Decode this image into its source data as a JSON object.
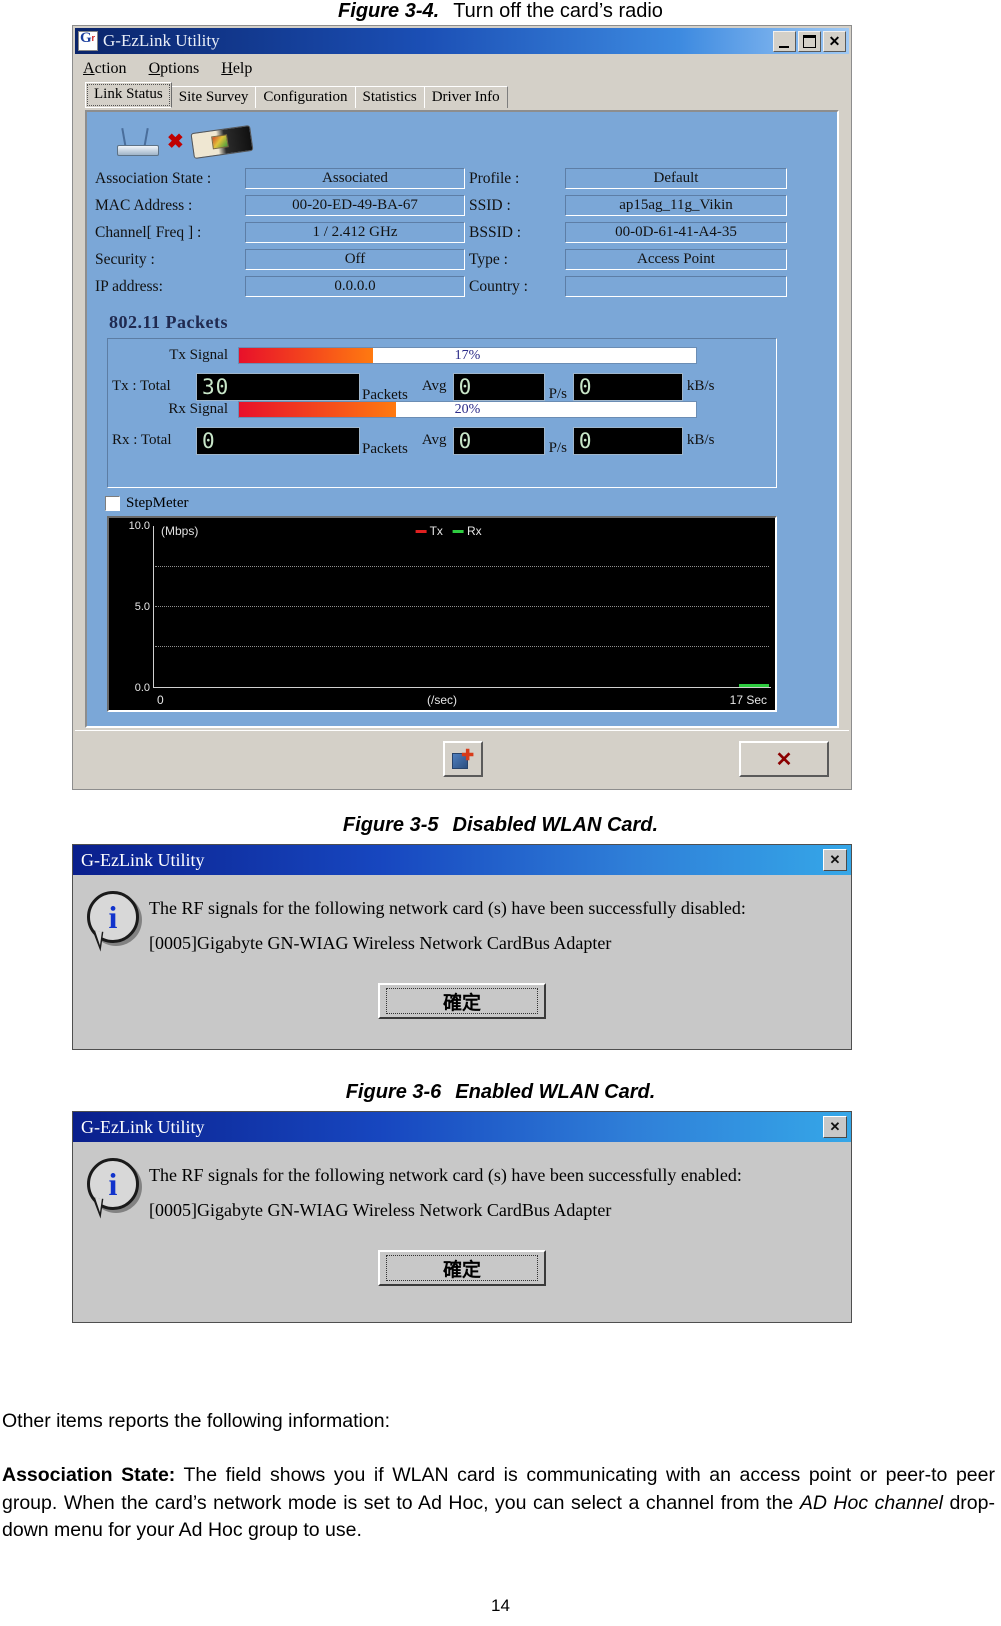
{
  "figures": {
    "fig34": {
      "label": "Figure 3-4.",
      "text": "Turn off the card’s radio"
    },
    "fig35": {
      "label": "Figure 3-5",
      "text": "Disabled WLAN Card."
    },
    "fig36": {
      "label": "Figure 3-6",
      "text": "Enabled WLAN Card."
    }
  },
  "utility": {
    "title": "G-EzLink Utility",
    "window_buttons": {
      "minimize": "_",
      "maximize": "□",
      "close": "✕"
    },
    "menu": [
      "Action",
      "Options",
      "Help"
    ],
    "tabs": [
      {
        "label": "Link Status",
        "active": true
      },
      {
        "label": "Site Survey",
        "active": false
      },
      {
        "label": "Configuration",
        "active": false
      },
      {
        "label": "Statistics",
        "active": false
      },
      {
        "label": "Driver Info",
        "active": false
      }
    ],
    "status_icons": {
      "access_point": "access-point-icon",
      "disconnect": "✖",
      "card": "pc-card-icon"
    },
    "fields_left": [
      {
        "label": "Association State :",
        "value": "Associated"
      },
      {
        "label": "MAC Address :",
        "value": "00-20-ED-49-BA-67"
      },
      {
        "label": "Channel[ Freq ] :",
        "value": "1 / 2.412 GHz"
      },
      {
        "label": "Security :",
        "value": "Off"
      },
      {
        "label": "IP address:",
        "value": "0.0.0.0"
      }
    ],
    "fields_right": [
      {
        "label": "Profile :",
        "value": "Default"
      },
      {
        "label": "SSID :",
        "value": "ap15ag_11g_Vikin"
      },
      {
        "label": "BSSID :",
        "value": "00-0D-61-41-A4-35"
      },
      {
        "label": "Type :",
        "value": "Access Point"
      },
      {
        "label": "Country :",
        "value": ""
      }
    ],
    "packets": {
      "section_title": "802.11  Packets",
      "tx_signal_label": "Tx Signal",
      "tx_signal_pct": "17%",
      "tx_signal_value": 17,
      "rx_signal_label": "Rx Signal",
      "rx_signal_pct": "20%",
      "rx_signal_value": 20,
      "tx_row_label": "Tx :  Total",
      "rx_row_label": "Rx :  Total",
      "tx_total": "30",
      "rx_total": "0",
      "tx_avg": "0",
      "rx_avg": "0",
      "tx_rate": "0",
      "rx_rate": "0",
      "packets_unit": "Packets",
      "avg_label": "Avg",
      "ps_unit": "P/s",
      "kbs_unit": "kB/s",
      "stepmeter_label": "StepMeter",
      "stepmeter_checked": false
    },
    "buttons": {
      "radio_toggle": "radio-toggle-icon",
      "close": "✕"
    }
  },
  "chart_data": {
    "type": "line",
    "title": "",
    "ylabel": "(Mbps)",
    "xlabel": "(/sec)",
    "ylim": [
      0,
      10
    ],
    "yticks": [
      "0.0",
      "5.0",
      "10.0"
    ],
    "xticks": [
      "0",
      "17 Sec"
    ],
    "xlim_label_left": "0",
    "xlim_label_right": "17 Sec",
    "grid": true,
    "legend_position": "top-center",
    "series": [
      {
        "name": "Tx",
        "color": "#e02020",
        "values": [
          0,
          0,
          0,
          0,
          0,
          0,
          0,
          0,
          0,
          0,
          0,
          0,
          0,
          0,
          0,
          0,
          0,
          0
        ]
      },
      {
        "name": "Rx",
        "color": "#2ecc40",
        "values": [
          0,
          0,
          0,
          0,
          0,
          0,
          0,
          0,
          0,
          0,
          0,
          0,
          0,
          0,
          0,
          0,
          0.1,
          0.1
        ]
      }
    ],
    "x": [
      0,
      1,
      2,
      3,
      4,
      5,
      6,
      7,
      8,
      9,
      10,
      11,
      12,
      13,
      14,
      15,
      16,
      17
    ]
  },
  "dialog_disabled": {
    "title": "G-EzLink Utility",
    "close_glyph": "✕",
    "line1": "The RF signals for the following network card (s) have been successfully disabled:",
    "line2": "[0005]Gigabyte GN-WIAG Wireless Network CardBus Adapter",
    "ok_label": "確定",
    "icon": "info-icon"
  },
  "dialog_enabled": {
    "title": "G-EzLink Utility",
    "close_glyph": "✕",
    "line1": "The RF signals for the following network card (s) have been successfully enabled:",
    "line2": "[0005]Gigabyte GN-WIAG Wireless Network CardBus Adapter",
    "ok_label": "確定",
    "icon": "info-icon"
  },
  "prose": {
    "intro": "Other items reports the following information:",
    "assoc_term": "Association State:",
    "assoc_part1": " The field shows you if WLAN card is communicating with an access point or peer-to peer group.  When the card’s network mode is set to Ad Hoc, you can select a channel from the ",
    "assoc_italic": "AD Hoc channel",
    "assoc_part2": " drop-down menu for your Ad Hoc group to use."
  },
  "page_number": "14"
}
